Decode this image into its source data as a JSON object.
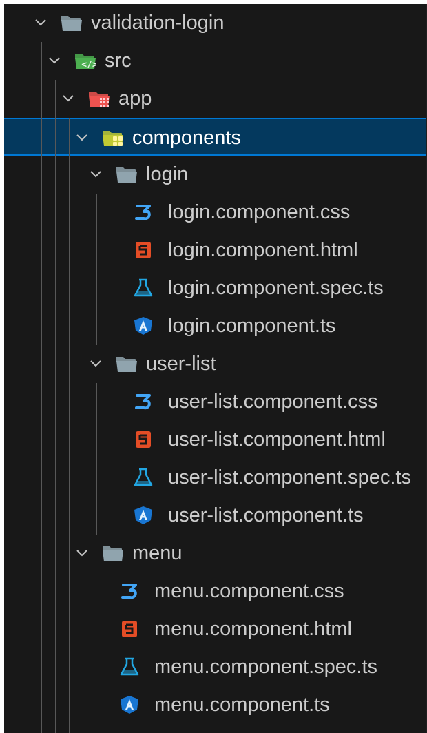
{
  "explorer": {
    "items": [
      {
        "label": "validation-login",
        "kind": "folder",
        "icon": "folder-icon",
        "depth": 0
      },
      {
        "label": "src",
        "kind": "folder-src",
        "icon": "folder-src-icon",
        "depth": 1
      },
      {
        "label": "app",
        "kind": "folder-app",
        "icon": "folder-app-icon",
        "depth": 2
      },
      {
        "label": "components",
        "kind": "folder-components",
        "icon": "folder-components-icon",
        "depth": 3,
        "selected": true
      },
      {
        "label": "login",
        "kind": "folder",
        "icon": "folder-icon",
        "depth": 4
      },
      {
        "label": "login.component.css",
        "kind": "css",
        "icon": "css-file-icon",
        "depth": 5
      },
      {
        "label": "login.component.html",
        "kind": "html",
        "icon": "html-file-icon",
        "depth": 5
      },
      {
        "label": "login.component.spec.ts",
        "kind": "spec",
        "icon": "test-flask-icon",
        "depth": 5
      },
      {
        "label": "login.component.ts",
        "kind": "angular",
        "icon": "angular-component-icon",
        "depth": 5
      },
      {
        "label": "user-list",
        "kind": "folder",
        "icon": "folder-icon",
        "depth": 4
      },
      {
        "label": "user-list.component.css",
        "kind": "css",
        "icon": "css-file-icon",
        "depth": 5
      },
      {
        "label": "user-list.component.html",
        "kind": "html",
        "icon": "html-file-icon",
        "depth": 5
      },
      {
        "label": "user-list.component.spec.ts",
        "kind": "spec",
        "icon": "test-flask-icon",
        "depth": 5
      },
      {
        "label": "user-list.component.ts",
        "kind": "angular",
        "icon": "angular-component-icon",
        "depth": 5
      },
      {
        "label": "menu",
        "kind": "folder",
        "icon": "folder-icon",
        "depth": 3
      },
      {
        "label": "menu.component.css",
        "kind": "css",
        "icon": "css-file-icon",
        "depth": 4
      },
      {
        "label": "menu.component.html",
        "kind": "html",
        "icon": "html-file-icon",
        "depth": 4
      },
      {
        "label": "menu.component.spec.ts",
        "kind": "spec",
        "icon": "test-flask-icon",
        "depth": 4
      },
      {
        "label": "menu.component.ts",
        "kind": "angular",
        "icon": "angular-component-icon",
        "depth": 4
      }
    ]
  },
  "colors": {
    "background": "#181818",
    "selection": "#04395e",
    "selection_border": "#0078d4",
    "text": "#cccccc",
    "css": "#42a5f5",
    "html": "#e44d26",
    "spec": "#22a6e2",
    "angular": "#1976d2",
    "folder": "#90a4ae",
    "src_folder": "#4caf50",
    "app_folder": "#ef5350",
    "components_folder": "#c0ca33"
  }
}
